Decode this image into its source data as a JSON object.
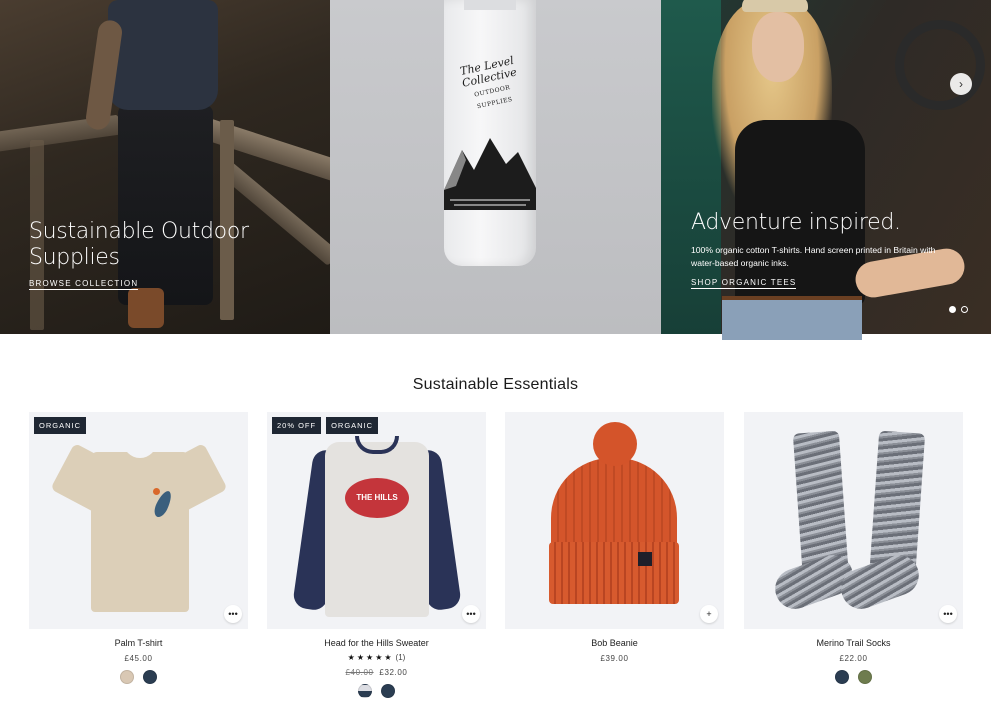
{
  "hero": {
    "slides": [
      {
        "title": "Sustainable Outdoor Supplies",
        "link_label": "BROWSE COLLECTION"
      },
      {
        "bottle_logo": "The Level Collective",
        "bottle_sub": "OUTDOOR SUPPLIES"
      },
      {
        "title": "Adventure inspired.",
        "description": "100% organic cotton T-shirts. Hand screen printed in Britain with water-based organic inks.",
        "link_label": "SHOP ORGANIC TEES"
      }
    ],
    "next_icon": "›",
    "pager": {
      "count": 2,
      "active": 1
    }
  },
  "section": {
    "title": "Sustainable Essentials"
  },
  "products": [
    {
      "name": "Palm T-shirt",
      "badges": [
        "ORGANIC"
      ],
      "price": "£45.00",
      "old_price": "",
      "action_icon": "•••",
      "swatches": [
        "#d9c8b4",
        "#2b3d52"
      ]
    },
    {
      "name": "Head for the Hills Sweater",
      "badges": [
        "20% OFF",
        "ORGANIC"
      ],
      "rating_stars": "★★★★★",
      "rating_count": "(1)",
      "old_price": "£40.00",
      "price": "£32.00",
      "action_icon": "•••",
      "logo_text": "THE HILLS",
      "swatches": [
        "#dcdde3",
        "#2b3d52"
      ]
    },
    {
      "name": "Bob Beanie",
      "badges": [],
      "price": "£39.00",
      "old_price": "",
      "action_icon": "+",
      "swatches": []
    },
    {
      "name": "Merino Trail Socks",
      "badges": [],
      "price": "£22.00",
      "old_price": "",
      "action_icon": "•••",
      "swatches": [
        "#2b3d52",
        "#6e7c4e"
      ]
    }
  ]
}
